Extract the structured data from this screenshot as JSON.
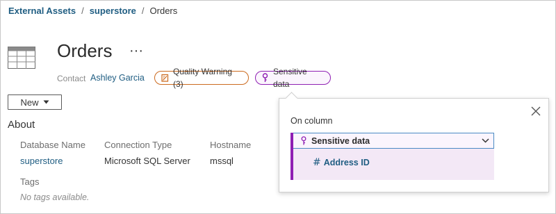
{
  "breadcrumb": {
    "items": [
      "External Assets",
      "superstore",
      "Orders"
    ],
    "separator": "/"
  },
  "header": {
    "title": "Orders",
    "more_label": "···",
    "contact_label": "Contact",
    "contact_name": "Ashley Garcia"
  },
  "badges": {
    "quality_warning": "Quality Warning (3)",
    "sensitive": "Sensitive data"
  },
  "toolbar": {
    "new_label": "New"
  },
  "about": {
    "heading": "About",
    "columns": [
      {
        "label": "Database Name",
        "value": "superstore"
      },
      {
        "label": "Connection Type",
        "value": "Microsoft SQL Server"
      },
      {
        "label": "Hostname",
        "value": "mssql"
      }
    ],
    "tags_label": "Tags",
    "tags_empty": "No tags available."
  },
  "popover": {
    "heading": "On column",
    "selected": "Sensitive data",
    "column_item": "Address ID"
  },
  "colors": {
    "link": "#1f5d82",
    "warning": "#cc6a1e",
    "sensitive": "#8f1fb3",
    "focus": "#4a8ac4"
  }
}
